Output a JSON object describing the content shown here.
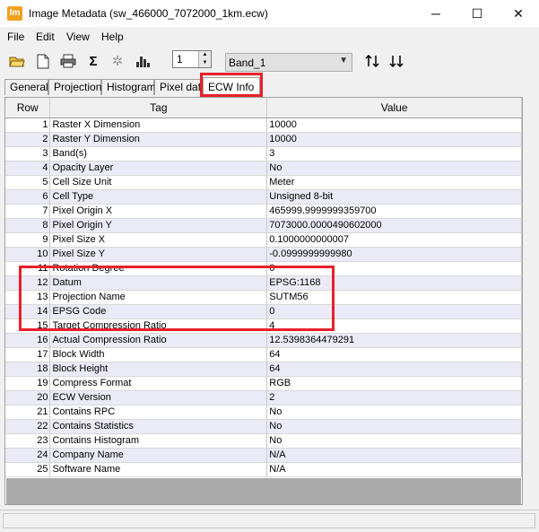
{
  "window": {
    "title": "Image Metadata (sw_466000_7072000_1km.ecw)",
    "app_icon_text": "Im",
    "minimize": "─",
    "maximize": "☐",
    "close": "✕"
  },
  "menu": [
    "File",
    "Edit",
    "View",
    "Help"
  ],
  "toolbar": {
    "icons": [
      "open-folder-icon",
      "new-document-icon",
      "print-icon",
      "sum-sigma-icon",
      "settings-gear-icon",
      "histogram-icon"
    ],
    "page_value": "1",
    "band_select": "Band_1",
    "sort_asc_icon": "sort-ascending-icon",
    "sort_desc_icon": "sort-descending-icon"
  },
  "tabs": [
    "General",
    "Projection",
    "Histogram",
    "Pixel data",
    "ECW Info"
  ],
  "active_tab": "ECW Info",
  "table": {
    "headers": [
      "Row",
      "Tag",
      "Value"
    ],
    "rows": [
      {
        "n": "1",
        "tag": "Raster X Dimension",
        "value": "10000"
      },
      {
        "n": "2",
        "tag": "Raster Y Dimension",
        "value": "10000"
      },
      {
        "n": "3",
        "tag": "Band(s)",
        "value": "3"
      },
      {
        "n": "4",
        "tag": "Opacity Layer",
        "value": "No"
      },
      {
        "n": "5",
        "tag": "Cell Size Unit",
        "value": "Meter"
      },
      {
        "n": "6",
        "tag": "Cell Type",
        "value": "Unsigned 8-bit"
      },
      {
        "n": "7",
        "tag": "Pixel Origin X",
        "value": "465999.9999999359700"
      },
      {
        "n": "8",
        "tag": "Pixel Origin Y",
        "value": "7073000.0000490602000"
      },
      {
        "n": "9",
        "tag": "Pixel Size X",
        "value": "0.1000000000007"
      },
      {
        "n": "10",
        "tag": "Pixel Size Y",
        "value": "-0.0999999999980"
      },
      {
        "n": "11",
        "tag": "Rotation Degree",
        "value": "0"
      },
      {
        "n": "12",
        "tag": "Datum",
        "value": "EPSG:1168"
      },
      {
        "n": "13",
        "tag": "Projection Name",
        "value": "SUTM56"
      },
      {
        "n": "14",
        "tag": "EPSG Code",
        "value": "0"
      },
      {
        "n": "15",
        "tag": "Target Compression Ratio",
        "value": "4"
      },
      {
        "n": "16",
        "tag": "Actual Compression Ratio",
        "value": "12.5398364479291"
      },
      {
        "n": "17",
        "tag": "Block Width",
        "value": "64"
      },
      {
        "n": "18",
        "tag": "Block Height",
        "value": "64"
      },
      {
        "n": "19",
        "tag": "Compress Format",
        "value": "RGB"
      },
      {
        "n": "20",
        "tag": "ECW Version",
        "value": "2"
      },
      {
        "n": "21",
        "tag": "Contains RPC",
        "value": "No"
      },
      {
        "n": "22",
        "tag": "Contains Statistics",
        "value": "No"
      },
      {
        "n": "23",
        "tag": "Contains Histogram",
        "value": "No"
      },
      {
        "n": "24",
        "tag": "Company Name",
        "value": "N/A"
      },
      {
        "n": "25",
        "tag": "Software Name",
        "value": "N/A"
      }
    ]
  },
  "colors": {
    "highlight": "#e8202a",
    "row_alt": "#ebebf7",
    "empty_area": "#aaaaaa"
  }
}
